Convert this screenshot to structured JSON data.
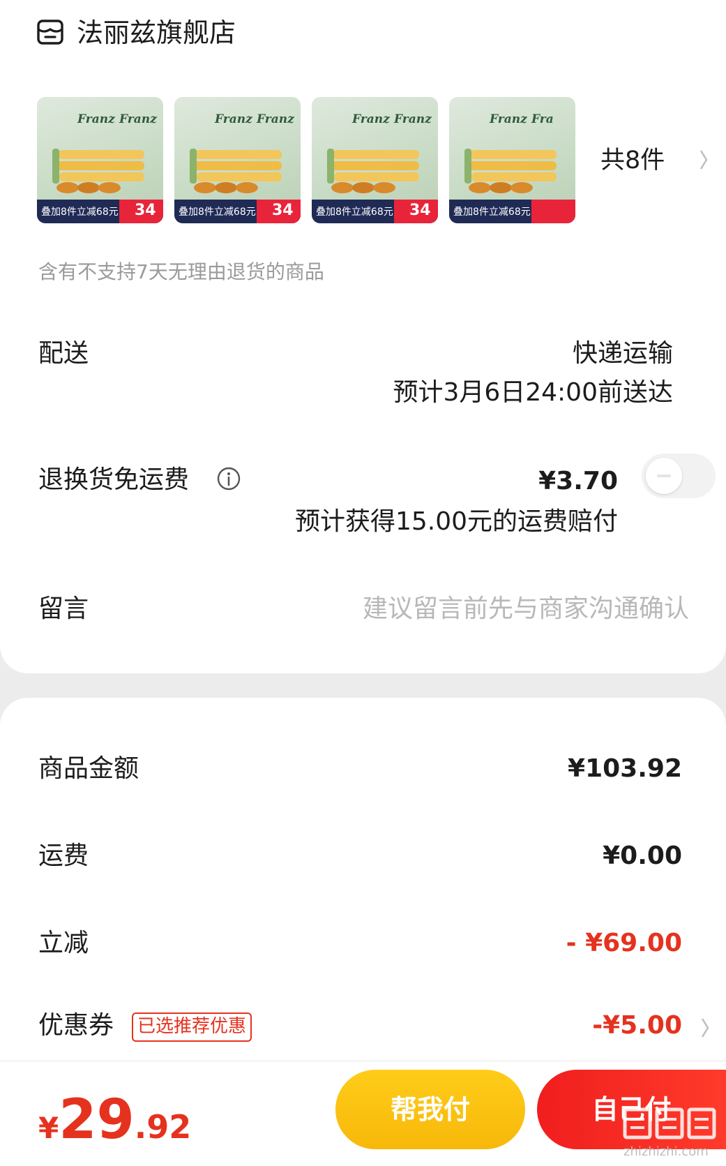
{
  "store": {
    "name": "法丽兹旗舰店",
    "icon": "store-icon"
  },
  "products": {
    "thumbnails": [
      {
        "brand": "Franz",
        "brand2": "Franz",
        "promo": "叠加8件立减68元",
        "price": "34"
      },
      {
        "brand": "Franz",
        "brand2": "Franz",
        "promo": "叠加8件立减68元",
        "price": "34"
      },
      {
        "brand": "Franz",
        "brand2": "Franz",
        "promo": "叠加8件立减68元",
        "price": "34"
      },
      {
        "brand": "Franz",
        "brand2": "Fra",
        "promo": "叠加8件立减68元",
        "price": ""
      }
    ],
    "count_label": "共8件",
    "notice": "含有不支持7天无理由退货的商品"
  },
  "delivery": {
    "label": "配送",
    "method": "快递运输",
    "eta": "预计3月6日24:00前送达"
  },
  "return_insurance": {
    "label": "退换货免运费",
    "price": "¥3.70",
    "note": "预计获得15.00元的运费赔付",
    "enabled": false
  },
  "message": {
    "label": "留言",
    "placeholder": "建议留言前先与商家沟通确认"
  },
  "summary": {
    "goods_label": "商品金额",
    "goods_value": "¥103.92",
    "shipping_label": "运费",
    "shipping_value": "¥0.00",
    "discount_label": "立减",
    "discount_value": "- ¥69.00",
    "coupon_label": "优惠券",
    "coupon_tag": "已选推荐优惠",
    "coupon_value": "-¥5.00"
  },
  "footer": {
    "currency": "¥",
    "total_int": "29",
    "total_dec": ".92",
    "help_pay_label": "帮我付",
    "self_pay_label": "自己付"
  },
  "watermark": {
    "text": "值值值",
    "url": "zhizhizhi.com"
  },
  "colors": {
    "accent_red": "#e5321e",
    "help_yellow": "#f7b80a",
    "pay_red": "#f01e1e"
  }
}
